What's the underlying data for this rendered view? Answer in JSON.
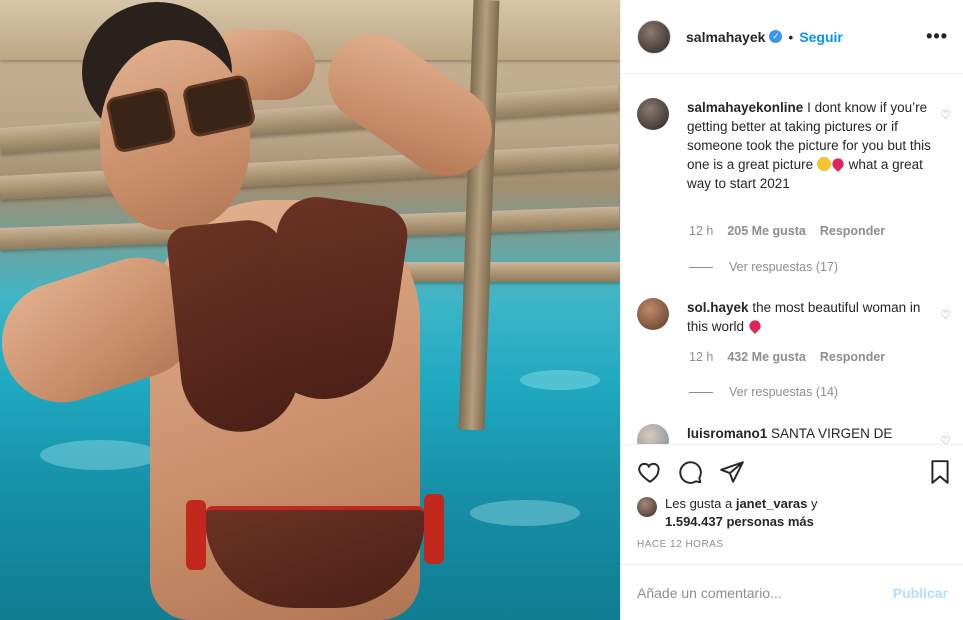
{
  "post": {
    "username": "salmahayek",
    "verified_mark": "✓",
    "dot": "•",
    "follow_label": "Seguir",
    "more_label": "•••"
  },
  "comments": [
    {
      "username": "salmahayekonline",
      "text_before": "I dont know if you’re getting better at taking pictures or if someone took the picture for you but this one is a great picture",
      "text_after": "what a great way to start 2021",
      "time": "12 h",
      "likes": "205 Me gusta",
      "reply_label": "Responder",
      "view_replies": "Ver respuestas (17)"
    },
    {
      "username": "sol.hayek",
      "text_before": "the most beautiful woman in this world",
      "time": "12 h",
      "likes": "432 Me gusta",
      "reply_label": "Responder",
      "view_replies": "Ver respuestas (14)"
    },
    {
      "username": "luisromano1",
      "text_before": "SANTA VIRGEN DE"
    }
  ],
  "likes": {
    "prefix": "Les gusta a",
    "user": "janet_varas",
    "conj": "y",
    "count": "1.594.437 personas más"
  },
  "timestamp": "HACE 12 HORAS",
  "add_comment": {
    "placeholder": "Añade un comentario...",
    "publish_label": "Publicar"
  },
  "colors": {
    "accent": "#0095f6",
    "publish_disabled": "#b2dffc",
    "verified": "#3897f0",
    "heart_emoji": "#e0245e",
    "muted": "#8e8e8e"
  },
  "icons": [
    "heart-icon",
    "comment-icon",
    "share-icon",
    "bookmark-icon",
    "more-options-icon",
    "verified-icon"
  ]
}
